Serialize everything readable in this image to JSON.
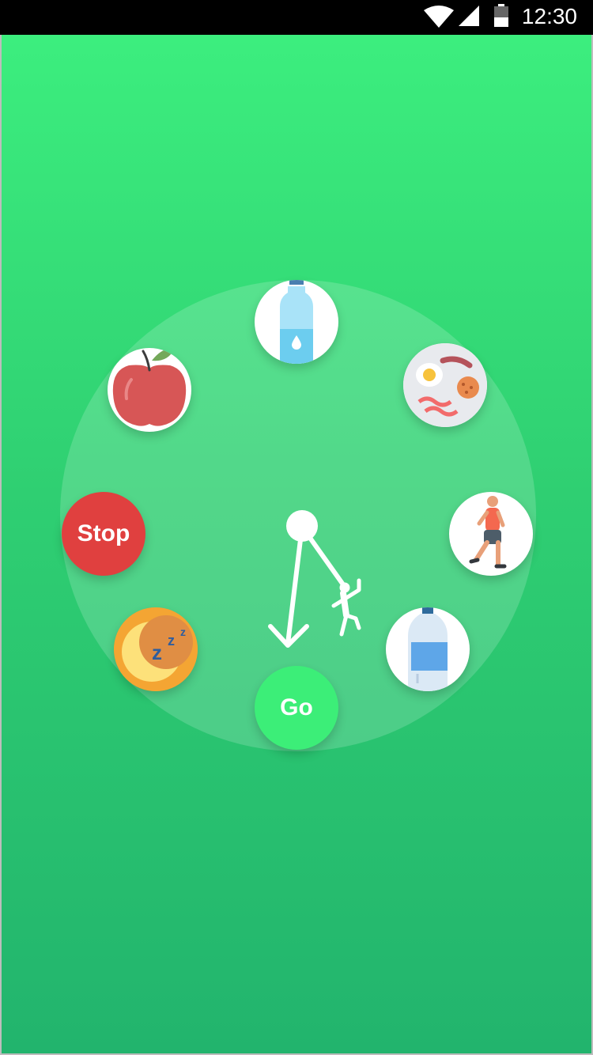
{
  "status_bar": {
    "time": "12:30",
    "icons": [
      "wifi-icon",
      "signal-icon",
      "battery-icon"
    ]
  },
  "colors": {
    "accent_green": "#3cee78",
    "stop_red": "#e0403f",
    "background_top": "#3cee7e",
    "background_bottom": "#22b46d"
  },
  "dial": {
    "nodes": [
      {
        "name": "water-bottle-small",
        "icon": "water-bottle-icon"
      },
      {
        "name": "breakfast",
        "icon": "breakfast-plate-icon"
      },
      {
        "name": "running",
        "icon": "runner-icon"
      },
      {
        "name": "water-bottle-large",
        "icon": "water-bottle-icon"
      },
      {
        "name": "sleep",
        "icon": "moon-sleep-icon"
      },
      {
        "name": "apple",
        "icon": "apple-icon"
      }
    ],
    "stop_label": "Stop",
    "go_label": "Go"
  }
}
